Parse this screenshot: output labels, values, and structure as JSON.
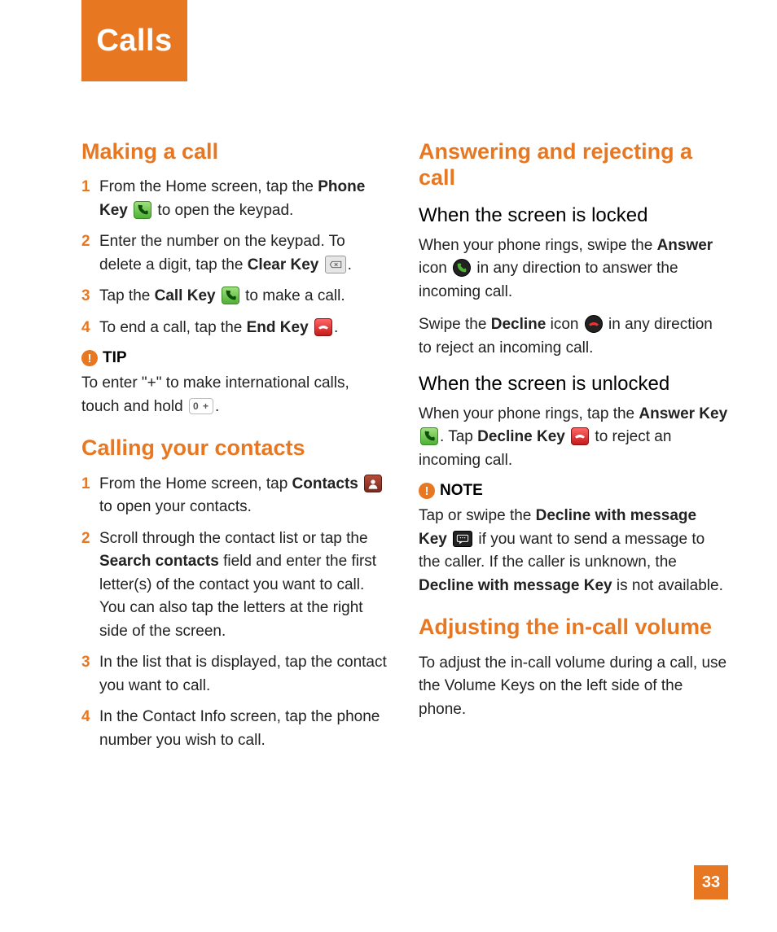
{
  "pageTitle": "Calls",
  "pageNumber": "33",
  "left": {
    "s1": {
      "heading": "Making a call",
      "items": [
        {
          "num": "1",
          "pre": "From the Home screen, tap the ",
          "bold": "Phone Key",
          "post1": " ",
          "icon": "phone-green",
          "post2": " to open the keypad."
        },
        {
          "num": "2",
          "pre": "Enter the number on the keypad. To delete a digit, tap the ",
          "bold": "Clear Key",
          "post1": " ",
          "icon": "clear",
          "post2": "."
        },
        {
          "num": "3",
          "pre": "Tap the ",
          "bold": "Call Key",
          "post1": " ",
          "icon": "phone-green",
          "post2": " to make a call."
        },
        {
          "num": "4",
          "pre": "To end a call, tap the ",
          "bold": "End Key",
          "post1": " ",
          "icon": "end-red",
          "post2": "."
        }
      ],
      "tipLabel": "TIP",
      "tipText": "To enter \"+\" to make international calls, touch and hold ",
      "tipZero": "0 +",
      "tipEnd": "."
    },
    "s2": {
      "heading": "Calling your contacts",
      "items": [
        {
          "num": "1",
          "pre": "From the Home screen, tap ",
          "bold": "Contacts",
          "post1": " ",
          "icon": "contacts",
          "post2": " to open your contacts."
        },
        {
          "num": "2",
          "plain": "Scroll through the contact list or tap the ",
          "bold": "Search contacts",
          "post": " field and enter the first letter(s) of the contact you want to call. You can also tap the letters at the right side of the screen."
        },
        {
          "num": "3",
          "plain2": "In the list that is displayed, tap the contact you want to call."
        },
        {
          "num": "4",
          "plain2": "In the Contact Info screen, tap the phone number you wish to call."
        }
      ]
    }
  },
  "right": {
    "s3": {
      "heading": "Answering and rejecting a call",
      "sub1": "When the screen is locked",
      "p1a": "When your phone rings, swipe the ",
      "p1b": "Answer",
      "p1c": " icon ",
      "p1d": " in any direction to answer the incoming call.",
      "p2a": "Swipe the ",
      "p2b": "Decline",
      "p2c": " icon ",
      "p2d": " in any direction to reject an incoming call.",
      "sub2": "When the screen is unlocked",
      "p3a": "When your phone rings, tap the ",
      "p3b": "Answer Key",
      "p3c": " ",
      "p3d": ". Tap ",
      "p3e": "Decline Key",
      "p3f": " ",
      "p3g": " to reject an incoming call.",
      "noteLabel": "NOTE",
      "noteA": "Tap or swipe the ",
      "noteB": "Decline with message Key",
      "noteC": " ",
      "noteD": " if you want to send a message to the caller. If the caller is unknown, the ",
      "noteE": "Decline with message Key",
      "noteF": " is not available."
    },
    "s4": {
      "heading": "Adjusting the in-call volume",
      "p": "To adjust the in-call volume during a call, use the Volume Keys on the left side of the phone."
    }
  }
}
